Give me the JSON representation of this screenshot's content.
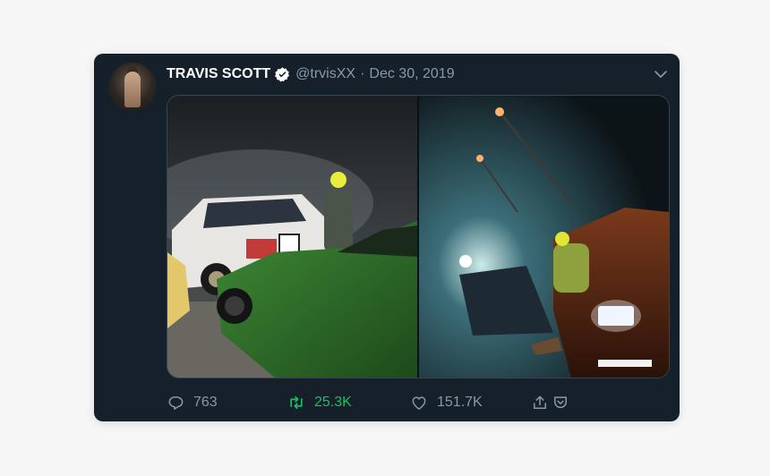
{
  "tweet": {
    "author_name": "TRAVIS SCOTT",
    "handle": "@trvisXX",
    "separator": "·",
    "date": "Dec 30, 2019"
  },
  "actions": {
    "replies": "763",
    "retweets": "25.3K",
    "likes": "151.7K"
  },
  "colors": {
    "card_bg": "#15202b",
    "muted": "#8899a6",
    "retweet_green": "#17bf63",
    "verified_white": "#ffffff"
  },
  "icons": [
    "verified-icon",
    "chevron-down-icon",
    "reply-icon",
    "retweet-icon",
    "like-icon",
    "share-icon",
    "pocket-icon"
  ]
}
